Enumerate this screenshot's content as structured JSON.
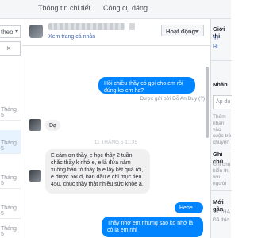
{
  "nav": {
    "tab_info": "Thông tin chi tiết",
    "tab_tools": "Công cụ đăng"
  },
  "left": {
    "filter_partial": "theo",
    "search_clear": "×",
    "conversation_dates": [
      "Tháng 5",
      "Tháng 5",
      "Tháng 5",
      "Tháng 5",
      "Tháng 5"
    ]
  },
  "chat": {
    "header": {
      "profile_link": "Xem trang cá nhân",
      "status_button": "Hoạt động"
    },
    "messages": {
      "m1": "Hồi chiều thầy có gọi cho em rồi đúng ko em ha?",
      "sent_by": "Được gửi bởi Đỗ An Duy (?)",
      "m2": "Dạ",
      "timestamp": "11 THÁNG 5 11:35",
      "m3": "E cảm ơn thầy, e học thầy 2 tuần, chắc thầy k nhớ e, e là đứa năm xuống bàn tỏ thầy lạ.e lấy kết quả rồi, e được 560đ, ban đầu e chỉ mục tiêu 450, chúc thầy thật nhiều sức khỏe ạ.",
      "m4": "Hehe",
      "m5": "Thầy nhớ em nhưng sao ko nhớ là cô la em nhỉ"
    }
  },
  "right": {
    "intro_head": "Giới thi",
    "intro_line1": "Tỉ",
    "intro_line2": "Hi",
    "label_head": "Nhãn",
    "label_input": "Áp dụ",
    "label_desc": "Thêm nhãn vào cuộc trò chuyện",
    "notes_head": "Ghi chú",
    "notes_desc": "Ghi chú hiển thị với người",
    "recent_head": "Mới gần",
    "recent_date": "25 THÁ",
    "recent_text": "Đã thíc"
  },
  "colors": {
    "accent": "#0084ff",
    "link": "#4267b2",
    "bubble_in": "#f1f0f0"
  }
}
